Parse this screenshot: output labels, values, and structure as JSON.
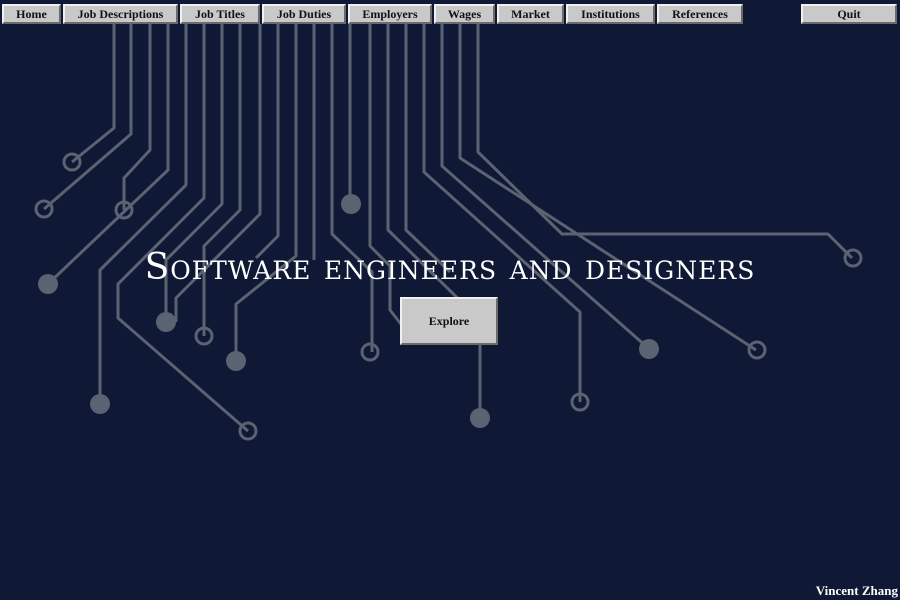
{
  "nav": {
    "items": [
      {
        "id": "home",
        "label": "Home"
      },
      {
        "id": "job-descriptions",
        "label": "Job Descriptions"
      },
      {
        "id": "job-titles",
        "label": "Job Titles"
      },
      {
        "id": "job-duties",
        "label": "Job Duties"
      },
      {
        "id": "employers",
        "label": "Employers"
      },
      {
        "id": "wages",
        "label": "Wages"
      },
      {
        "id": "market",
        "label": "Market"
      },
      {
        "id": "institutions",
        "label": "Institutions"
      },
      {
        "id": "references",
        "label": "References"
      }
    ],
    "quit_label": "Quit"
  },
  "hero": {
    "title": "Software engineers and designers",
    "explore_label": "Explore"
  },
  "footer": {
    "author": "Vincent Zhang"
  },
  "colors": {
    "background": "#0f1834",
    "circuit_line": "#5b6272",
    "button_face": "#c9c9c9",
    "text_light": "#ffffff"
  },
  "background_graphic": "circuit-board"
}
